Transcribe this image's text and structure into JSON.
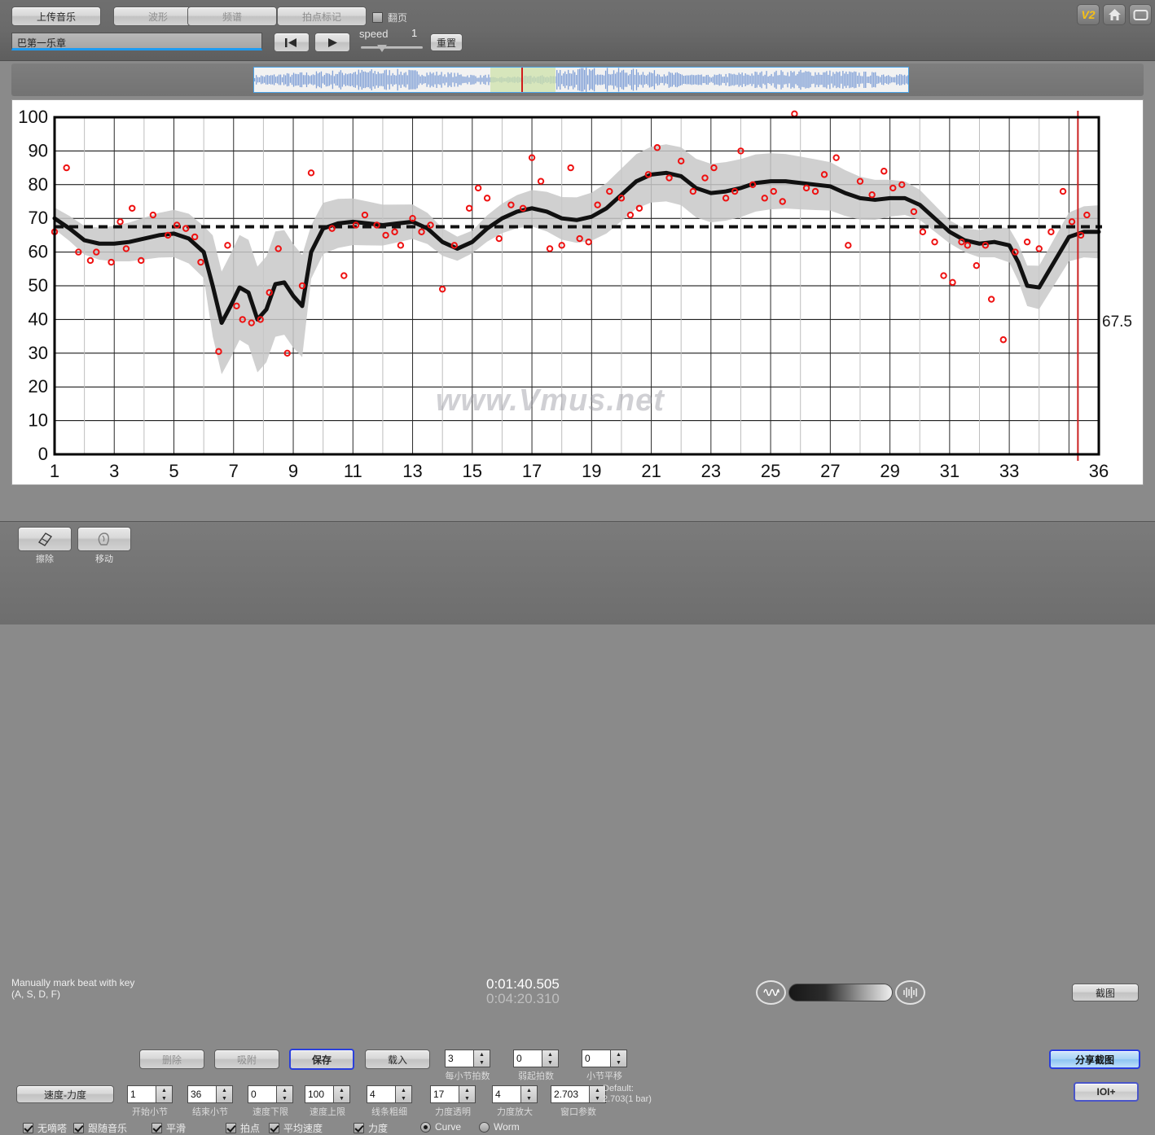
{
  "topbar": {
    "buttons": [
      {
        "id": "upload",
        "label": "上传音乐"
      },
      {
        "id": "waveform",
        "label": "波形"
      },
      {
        "id": "spectrum",
        "label": "频谱"
      },
      {
        "id": "beatmark",
        "label": "拍点标记"
      }
    ],
    "page_turn_checkbox": {
      "label": "翻页",
      "checked": false
    },
    "title_field": {
      "value": "巴第一乐章",
      "placeholder": ""
    },
    "transport": {
      "prev_icon": "skip-back-icon",
      "play_icon": "play-icon"
    },
    "speed": {
      "label": "speed",
      "value": "1"
    },
    "reset_label": "重置",
    "icons": [
      {
        "name": "v2-badge",
        "label": "V2"
      },
      {
        "name": "home-icon",
        "label": ""
      },
      {
        "name": "fullscreen-icon",
        "label": ""
      }
    ]
  },
  "chart_data": {
    "type": "line",
    "title": "",
    "xlabel": "",
    "ylabel": "",
    "watermark": "www.Vmus.net",
    "xlim": [
      1,
      36
    ],
    "ylim": [
      0,
      100
    ],
    "grid": true,
    "xticks": [
      1,
      3,
      5,
      7,
      9,
      11,
      13,
      15,
      17,
      19,
      21,
      23,
      25,
      27,
      29,
      31,
      33,
      36
    ],
    "yticks": [
      0,
      10,
      20,
      30,
      40,
      50,
      60,
      70,
      80,
      90,
      100
    ],
    "mean_line": {
      "value": 67.5,
      "label": "67.5",
      "style": "dashed",
      "color": "#111111"
    },
    "cursor_line": {
      "x": 35.3,
      "color": "#cc2222"
    },
    "series": [
      {
        "name": "tempo-curve",
        "type": "line",
        "color": "#111111",
        "x": [
          1,
          1.5,
          2,
          2.5,
          3,
          3.5,
          4,
          4.5,
          5,
          5.5,
          6,
          6.3,
          6.6,
          6.9,
          7.2,
          7.5,
          7.8,
          8.1,
          8.4,
          8.7,
          9,
          9.3,
          9.6,
          10,
          10.5,
          11,
          11.5,
          12,
          12.5,
          13,
          13.5,
          14,
          14.5,
          15,
          15.5,
          16,
          16.5,
          17,
          17.5,
          18,
          18.5,
          19,
          19.5,
          20,
          20.5,
          21,
          21.5,
          22,
          22.5,
          23,
          23.5,
          24,
          24.5,
          25,
          25.5,
          26,
          26.5,
          27,
          27.5,
          28,
          28.5,
          29,
          29.5,
          30,
          30.5,
          31,
          31.5,
          32,
          32.5,
          33,
          33.3,
          33.6,
          34,
          34.5,
          35,
          35.5,
          36
        ],
        "y": [
          70,
          67,
          63.5,
          62.5,
          62.5,
          63,
          64,
          65,
          65.5,
          64,
          60,
          50,
          39,
          44,
          49.5,
          48,
          40,
          43,
          50.5,
          51,
          47,
          44,
          60,
          67,
          68.5,
          69,
          68.5,
          68,
          68.5,
          69,
          67,
          63,
          61,
          63,
          67,
          70,
          72,
          73,
          72,
          70,
          69.5,
          70.5,
          73,
          77,
          81,
          83,
          83.5,
          82.5,
          79,
          77.5,
          78,
          79,
          80.5,
          81,
          81,
          80.5,
          80,
          79.5,
          77.5,
          76,
          75.5,
          76,
          76,
          74,
          70,
          66,
          63.5,
          62.5,
          63,
          62,
          57,
          50,
          49.5,
          57,
          64.5,
          66,
          66,
          66.5
        ]
      },
      {
        "name": "velocity-points",
        "type": "scatter",
        "color": "#ee1111",
        "points": [
          [
            1,
            66
          ],
          [
            1.4,
            85
          ],
          [
            1.8,
            60
          ],
          [
            2.2,
            57.5
          ],
          [
            2.4,
            60
          ],
          [
            2.9,
            57
          ],
          [
            3.2,
            69
          ],
          [
            3.4,
            61
          ],
          [
            3.6,
            73
          ],
          [
            3.9,
            57.5
          ],
          [
            4.3,
            71
          ],
          [
            4.8,
            65
          ],
          [
            5.1,
            68
          ],
          [
            5.4,
            67
          ],
          [
            5.7,
            64.5
          ],
          [
            5.9,
            57
          ],
          [
            6.5,
            30.5
          ],
          [
            6.8,
            62
          ],
          [
            7.1,
            44
          ],
          [
            7.3,
            40
          ],
          [
            7.6,
            39
          ],
          [
            7.9,
            40
          ],
          [
            8.2,
            48
          ],
          [
            8.5,
            61
          ],
          [
            8.8,
            30
          ],
          [
            9.3,
            50
          ],
          [
            9.6,
            83.5
          ],
          [
            10.3,
            67
          ],
          [
            10.7,
            53
          ],
          [
            11.1,
            68
          ],
          [
            11.4,
            71
          ],
          [
            11.8,
            68
          ],
          [
            12.1,
            65
          ],
          [
            12.4,
            66
          ],
          [
            12.6,
            62
          ],
          [
            13,
            70
          ],
          [
            13.3,
            66
          ],
          [
            13.6,
            68
          ],
          [
            14,
            49
          ],
          [
            14.4,
            62
          ],
          [
            14.9,
            73
          ],
          [
            15.2,
            79
          ],
          [
            15.5,
            76
          ],
          [
            15.9,
            64
          ],
          [
            16.3,
            74
          ],
          [
            16.7,
            73
          ],
          [
            17,
            88
          ],
          [
            17.3,
            81
          ],
          [
            17.6,
            61
          ],
          [
            18,
            62
          ],
          [
            18.3,
            85
          ],
          [
            18.6,
            64
          ],
          [
            18.9,
            63
          ],
          [
            19.2,
            74
          ],
          [
            19.6,
            78
          ],
          [
            20,
            76
          ],
          [
            20.3,
            71
          ],
          [
            20.6,
            73
          ],
          [
            20.9,
            83
          ],
          [
            21.2,
            91
          ],
          [
            21.6,
            82
          ],
          [
            22,
            87
          ],
          [
            22.4,
            78
          ],
          [
            22.8,
            82
          ],
          [
            23.1,
            85
          ],
          [
            23.5,
            76
          ],
          [
            23.8,
            78
          ],
          [
            24,
            90
          ],
          [
            24.4,
            80
          ],
          [
            24.8,
            76
          ],
          [
            25.1,
            78
          ],
          [
            25.4,
            75
          ],
          [
            25.8,
            101
          ],
          [
            26.2,
            79
          ],
          [
            26.5,
            78
          ],
          [
            26.8,
            83
          ],
          [
            27.2,
            88
          ],
          [
            27.6,
            62
          ],
          [
            28,
            81
          ],
          [
            28.4,
            77
          ],
          [
            28.8,
            84
          ],
          [
            29.1,
            79
          ],
          [
            29.4,
            80
          ],
          [
            29.8,
            72
          ],
          [
            30.1,
            66
          ],
          [
            30.5,
            63
          ],
          [
            30.8,
            53
          ],
          [
            31.1,
            51
          ],
          [
            31.4,
            63
          ],
          [
            31.6,
            62
          ],
          [
            31.9,
            56
          ],
          [
            32.2,
            62
          ],
          [
            32.4,
            46
          ],
          [
            32.8,
            34
          ],
          [
            33.2,
            60
          ],
          [
            33.6,
            63
          ],
          [
            34,
            61
          ],
          [
            34.4,
            66
          ],
          [
            34.8,
            78
          ],
          [
            35.1,
            69
          ],
          [
            35.4,
            65
          ],
          [
            35.6,
            71
          ]
        ]
      }
    ]
  },
  "status": {
    "hint_line1": "Manually mark beat with key",
    "hint_line2": "(A, S, D, F)",
    "time_current": "0:01:40.505",
    "time_total": "0:04:20.310",
    "volume_icon_left": "wave-low-icon",
    "volume_icon_right": "wave-high-icon",
    "screenshot_label": "截图"
  },
  "bottom": {
    "tools": [
      {
        "id": "erase",
        "icon": "eraser-icon",
        "caption": "擦除"
      },
      {
        "id": "move",
        "icon": "hand-icon",
        "caption": "移动"
      }
    ],
    "actions": [
      {
        "id": "delete",
        "label": "删除",
        "state": "dim"
      },
      {
        "id": "snap",
        "label": "吸附",
        "state": "dim"
      },
      {
        "id": "save",
        "label": "保存",
        "state": "selected"
      },
      {
        "id": "load",
        "label": "载入",
        "state": "normal"
      }
    ],
    "spinners_row1": [
      {
        "id": "beats-per-bar",
        "value": "3",
        "caption": "每小节拍数"
      },
      {
        "id": "pickup-beats",
        "value": "0",
        "caption": "弱起拍数"
      },
      {
        "id": "bar-shift",
        "value": "0",
        "caption": "小节平移"
      }
    ],
    "vd_button_label": "速度-力度",
    "spinners_row2": [
      {
        "id": "start-bar",
        "value": "1",
        "caption": "开始小节"
      },
      {
        "id": "end-bar",
        "value": "36",
        "caption": "结束小节"
      },
      {
        "id": "tempo-min",
        "value": "0",
        "caption": "速度下限"
      },
      {
        "id": "tempo-max",
        "value": "100",
        "caption": "速度上限"
      },
      {
        "id": "line-width",
        "value": "4",
        "caption": "线条粗细"
      },
      {
        "id": "velocity-alpha",
        "value": "17",
        "caption": "力度透明"
      },
      {
        "id": "velocity-zoom",
        "value": "4",
        "caption": "力度放大"
      },
      {
        "id": "window-param",
        "value": "2.703",
        "caption": "窗口参数"
      }
    ],
    "default_note_line1": "Default:",
    "default_note_line2": "2.703(1 bar)",
    "checkboxes": [
      {
        "id": "no-tick",
        "label": "无嘀嗒",
        "checked": true
      },
      {
        "id": "follow-music",
        "label": "跟随音乐",
        "checked": true
      },
      {
        "id": "smooth",
        "label": "平滑",
        "checked": true
      },
      {
        "id": "beats",
        "label": "拍点",
        "checked": true
      },
      {
        "id": "avg-tempo",
        "label": "平均速度",
        "checked": true
      },
      {
        "id": "velocity",
        "label": "力度",
        "checked": true
      }
    ],
    "radios": [
      {
        "id": "curve",
        "label": "Curve",
        "checked": true
      },
      {
        "id": "worm",
        "label": "Worm",
        "checked": false
      }
    ],
    "share_label": "分享截图",
    "ioi_label": "IOI+"
  }
}
